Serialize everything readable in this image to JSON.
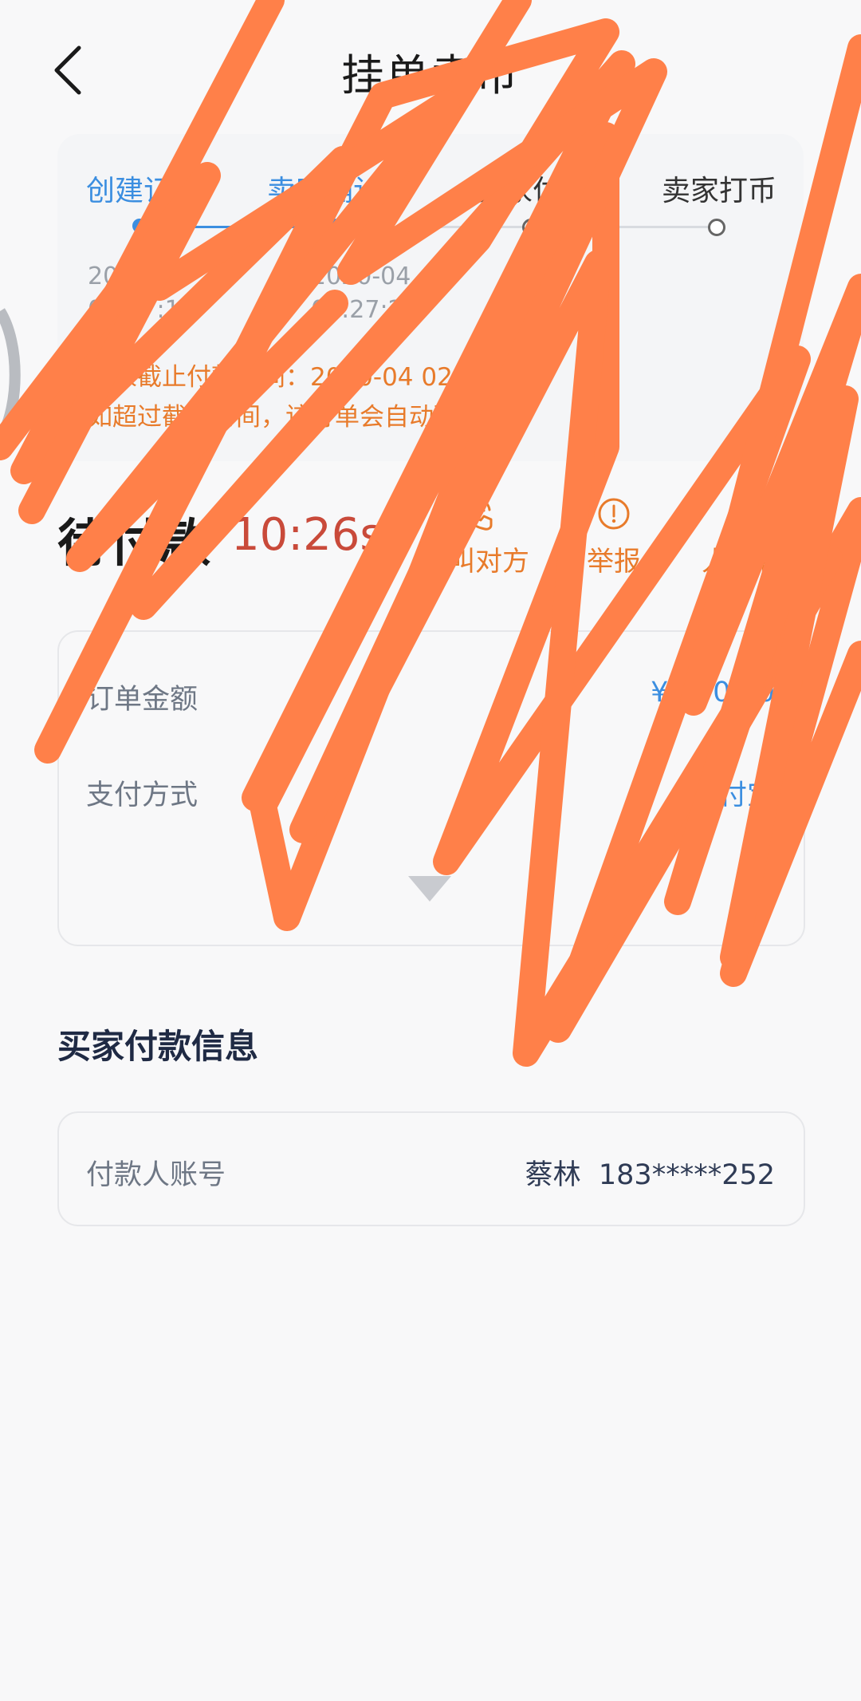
{
  "header": {
    "title": "挂单卖币"
  },
  "steps": [
    {
      "label": "创建订单",
      "time_line1": "2020-04",
      "time_line2": "02:27:11",
      "state": "done"
    },
    {
      "label": "卖家确认",
      "time_line1": "2020-04",
      "time_line2": "02:27:20",
      "state": "done"
    },
    {
      "label": "买家付款",
      "time_line1": "",
      "time_line2": "",
      "state": "todo"
    },
    {
      "label": "卖家打币",
      "time_line1": "",
      "time_line2": "",
      "state": "todo"
    }
  ],
  "notice": {
    "line1": "买家截止付款时间：2020-04 02:37:11",
    "line2": "如超过截止时间，该订单会自动取消。"
  },
  "status": {
    "title": "待付款",
    "countdown": "10:26s"
  },
  "actions": [
    {
      "label": "呼叫对方",
      "icon": "phone-icon"
    },
    {
      "label": "举报",
      "icon": "report-icon"
    },
    {
      "label": "人工客服",
      "icon": "support-icon"
    }
  ],
  "order": {
    "amount_label": "订单金额",
    "amount_value": "¥ 100.00",
    "payment_label": "支付方式",
    "payment_value": "支付宝"
  },
  "buyer_section": {
    "title": "买家付款信息"
  },
  "payer": {
    "label": "付款人账号",
    "name": "蔡林",
    "account": "183*****252"
  },
  "colors": {
    "accent": "#3b8ee0",
    "warning": "#e87b2b",
    "countdown": "#c94a3a",
    "scribble": "#ff8049"
  }
}
